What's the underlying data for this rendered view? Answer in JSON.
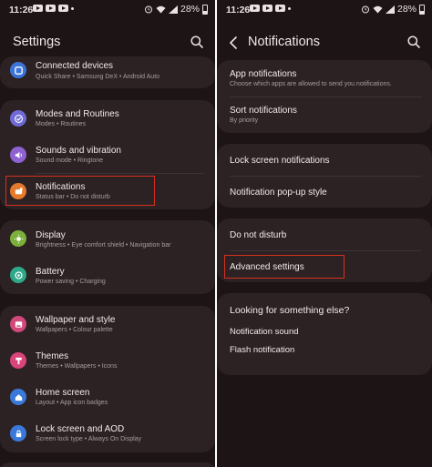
{
  "colors": {
    "highlight": "#d6301f",
    "panel_bg": "#1d1415",
    "card_bg": "#2c2224"
  },
  "left": {
    "status": {
      "time": "11:26",
      "battery": "28%"
    },
    "title": "Settings",
    "items": [
      {
        "title": "Connected devices",
        "sub": "Quick Share  •  Samsung DeX  •  Android Auto",
        "icon": "link-icon",
        "color": "#3b73d9"
      },
      {
        "title": "Modes and Routines",
        "sub": "Modes  •  Routines",
        "icon": "check-circle-icon",
        "color": "#6f6ad6"
      },
      {
        "title": "Sounds and vibration",
        "sub": "Sound mode  •  Ringtone",
        "icon": "speaker-icon",
        "color": "#8e62d1"
      },
      {
        "title": "Notifications",
        "sub": "Status bar  •  Do not disturb",
        "icon": "bell-icon",
        "color": "#e57a2c"
      },
      {
        "title": "Display",
        "sub": "Brightness  •  Eye comfort shield  •  Navigation bar",
        "icon": "sun-icon",
        "color": "#7bb03a"
      },
      {
        "title": "Battery",
        "sub": "Power saving  •  Charging",
        "icon": "battery-icon",
        "color": "#2fa88a"
      },
      {
        "title": "Wallpaper and style",
        "sub": "Wallpapers  •  Colour palette",
        "icon": "picture-icon",
        "color": "#d1487a"
      },
      {
        "title": "Themes",
        "sub": "Themes  •  Wallpapers  •  Icons",
        "icon": "theme-icon",
        "color": "#d9457b"
      },
      {
        "title": "Home screen",
        "sub": "Layout  •  App icon badges",
        "icon": "home-icon",
        "color": "#3a78d9"
      },
      {
        "title": "Lock screen and AOD",
        "sub": "Screen lock type  •  Always On Display",
        "icon": "lock-icon",
        "color": "#3a78d9"
      }
    ]
  },
  "right": {
    "status": {
      "time": "11:26",
      "battery": "28%"
    },
    "title": "Notifications",
    "items": [
      {
        "title": "App notifications",
        "sub": "Choose which apps are allowed to send you notifications."
      },
      {
        "title": "Sort notifications",
        "sub": "By priority"
      },
      {
        "title": "Lock screen notifications"
      },
      {
        "title": "Notification pop-up style"
      },
      {
        "title": "Do not disturb"
      },
      {
        "title": "Advanced settings"
      }
    ],
    "suggest": {
      "heading": "Looking for something else?",
      "links": [
        "Notification sound",
        "Flash notification"
      ]
    }
  }
}
